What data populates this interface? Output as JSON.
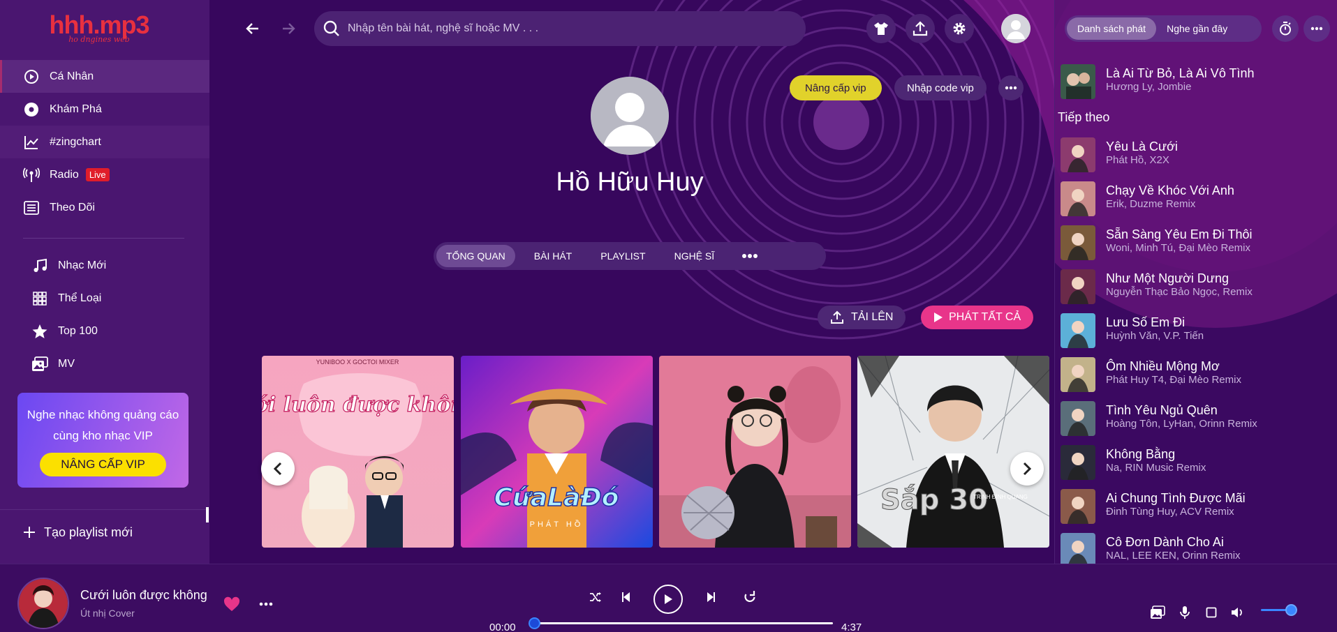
{
  "logo": {
    "main": "hhh.mp3",
    "sub": "ho dngines web"
  },
  "search": {
    "placeholder": "Nhập tên bài hát, nghệ sĩ hoặc MV . . ."
  },
  "sidebar": {
    "top_items": [
      {
        "label": "Cá Nhân",
        "icon": "play-circle-icon"
      },
      {
        "label": "Khám Phá",
        "icon": "disc-icon"
      },
      {
        "label": "#zingchart",
        "icon": "chart-line-icon"
      },
      {
        "label": "Radio",
        "icon": "radio-icon",
        "badge": "Live"
      },
      {
        "label": "Theo Dõi",
        "icon": "list-icon"
      }
    ],
    "bottom_items": [
      {
        "label": "Nhạc Mới",
        "icon": "music-note-icon"
      },
      {
        "label": "Thể Loại",
        "icon": "grid-icon"
      },
      {
        "label": "Top 100",
        "icon": "star-icon"
      },
      {
        "label": "MV",
        "icon": "mv-icon"
      }
    ],
    "vip_promo": {
      "text": "Nghe nhạc không quảng cáo cùng kho nhạc VIP",
      "button": "NÂNG CẤP VIP"
    },
    "create_playlist": "Tạo playlist mới"
  },
  "profile": {
    "name": "Hồ Hữu Huy",
    "upgrade_vip": "Nâng cấp vip",
    "enter_code": "Nhập code vip",
    "tabs": [
      "TỔNG QUAN",
      "BÀI HÁT",
      "PLAYLIST",
      "NGHỆ SĨ"
    ],
    "upload": "TẢI LÊN",
    "play_all": "PHÁT TẤT CẢ"
  },
  "cards": [
    {
      "top_text": "YUNIBOO X GOCTOI MIXER",
      "title_text": "Cưới luôn được không?"
    },
    {
      "title_text": "CứaLàĐó",
      "sub_text": "PHÁT HỒ"
    },
    {
      "title_text": ""
    },
    {
      "title_text": "Sắp 30",
      "sub_text": "TRỊNH ĐÌNH QUANG"
    }
  ],
  "right_panel": {
    "tabs": [
      "Danh sách phát",
      "Nghe gần đây"
    ],
    "now_playing": {
      "title": "Là Ai Từ Bỏ, Là Ai Vô Tình",
      "artist": "Hương Ly, Jombie"
    },
    "next_label": "Tiếp theo",
    "queue": [
      {
        "title": "Yêu Là Cưới",
        "artist": "Phát Hồ, X2X",
        "color": "#8c3b6e"
      },
      {
        "title": "Chạy Về Khóc Với Anh",
        "artist": "Erik, Duzme Remix",
        "color": "#c98a8a"
      },
      {
        "title": "Sẵn Sàng Yêu Em Đi Thôi",
        "artist": "Woni, Minh Tú, Đại Mèo Remix",
        "color": "#7a5a3a"
      },
      {
        "title": "Như Một Người Dưng",
        "artist": "Nguyễn Thạc Bảo Ngọc, Remix",
        "color": "#6b2a4a"
      },
      {
        "title": "Lưu Số Em Đi",
        "artist": "Huỳnh Văn, V.P. Tiến",
        "color": "#5cb0d8"
      },
      {
        "title": "Ôm Nhiều Mộng Mơ",
        "artist": "Phát Huy T4, Đại Mèo Remix",
        "color": "#c2b28a"
      },
      {
        "title": "Tình Yêu Ngủ Quên",
        "artist": "Hoàng Tôn, LyHan, Orinn Remix",
        "color": "#5a6e7a"
      },
      {
        "title": "Không Bằng",
        "artist": "Na, RIN Music Remix",
        "color": "#2a2a3a"
      },
      {
        "title": "Ai Chung Tình Được Mãi",
        "artist": "Đinh Tùng Huy, ACV Remix",
        "color": "#8a5a4a"
      },
      {
        "title": "Cô Đơn Dành Cho Ai",
        "artist": "NAL, LEE KEN, Orinn Remix",
        "color": "#6a8ab8"
      }
    ]
  },
  "player": {
    "title": "Cưới luôn được không",
    "artist": "Út nhị Cover",
    "current_time": "00:00",
    "duration": "4:37",
    "progress": 0,
    "volume": 0.85
  },
  "colors": {
    "accent_pink": "#e8358a",
    "vip_yellow": "#e1d22b",
    "bg": "#37075d",
    "live_red": "#e01d2a"
  }
}
